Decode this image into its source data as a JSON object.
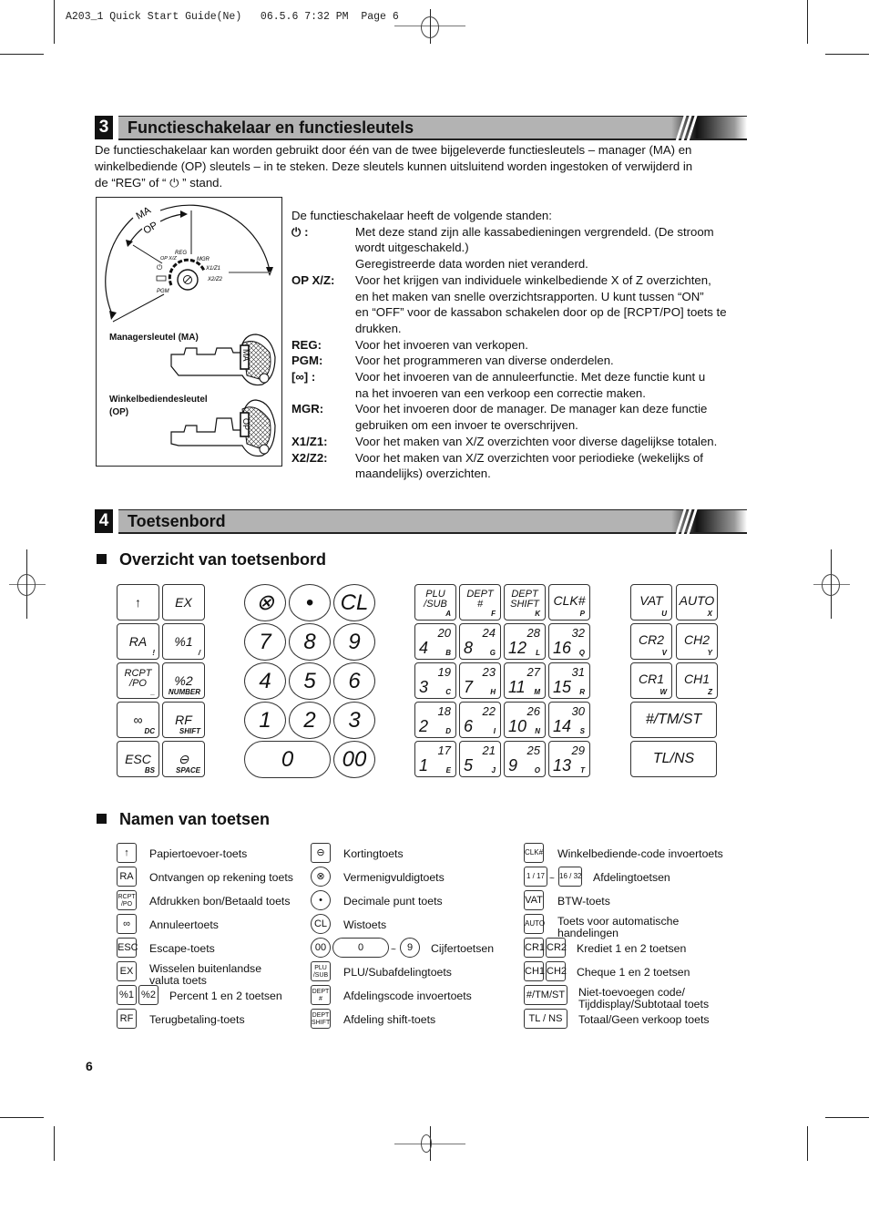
{
  "print_header": {
    "text": "A203_1 Quick Start Guide(Ne)   06.5.6 7:32 PM  Page 6"
  },
  "section3": {
    "number": "3",
    "title": "Functieschakelaar en functiesleutels",
    "intro": [
      "De functieschakelaar kan worden gebruikt door één van de twee bijgeleverde functiesleutels – manager (MA) en",
      "winkelbediende (OP) sleutels – in te steken. Deze sleutels kunnen uitsluitend worden ingestoken of verwijderd in",
      "de “REG” of “ ⏻ ” stand."
    ],
    "diagram": {
      "arc_ma": "MA",
      "arc_op": "OP",
      "switch_labels": {
        "opxz": "OP X/Z",
        "reg": "REG",
        "mgr": "MGR",
        "x1z1": "X1/Z1",
        "x2z2": "X2/Z2",
        "off": "⏻",
        "void": "∞",
        "pgm": "PGM"
      },
      "key_ma_caption": "Managersleutel (MA)",
      "key_ma_tag": "MA",
      "key_op_caption_1": "Winkelbediendesleutel",
      "key_op_caption_2": "(OP)",
      "key_op_tag": "OP"
    },
    "positions_intro": "De functieschakelaar heeft de volgende standen:",
    "positions": [
      {
        "key": "⏻ :",
        "lines": [
          "Met deze stand zijn alle kassabedieningen vergrendeld. (De stroom",
          "wordt uitgeschakeld.)",
          "Geregistreerde data worden niet veranderd."
        ]
      },
      {
        "key": "OP X/Z:",
        "lines": [
          "Voor het krijgen van individuele winkelbediende X of Z overzichten,",
          "en het maken van snelle  overzichtsrapporten. U kunt tussen “ON”",
          "en “OFF” voor de kassabon schakelen door op de [RCPT/PO] toets te",
          "drukken."
        ]
      },
      {
        "key": "REG:",
        "lines": [
          "Voor het invoeren van verkopen."
        ]
      },
      {
        "key": "PGM:",
        "lines": [
          "Voor het programmeren van diverse onderdelen."
        ]
      },
      {
        "key": "[∞] :",
        "lines": [
          "Voor het invoeren van de annuleerfunctie. Met deze functie kunt u",
          "na het invoeren van een verkoop een correctie maken."
        ]
      },
      {
        "key": "MGR:",
        "lines": [
          "Voor het invoeren door de manager. De manager kan deze functie",
          "gebruiken om een invoer te overschrijven."
        ]
      },
      {
        "key": "X1/Z1:",
        "lines": [
          "Voor het maken van X/Z overzichten voor diverse dagelijkse totalen."
        ]
      },
      {
        "key": "X2/Z2:",
        "lines": [
          "Voor het maken van X/Z overzichten voor periodieke (wekelijks of",
          "maandelijks) overzichten."
        ]
      }
    ]
  },
  "section4": {
    "number": "4",
    "title": "Toetsenbord",
    "overview_heading": "Overzicht van toetsenbord",
    "names_heading": "Namen van toetsen"
  },
  "keyboard": {
    "function_keys": [
      {
        "main": "↑",
        "sub": ""
      },
      {
        "main": "EX",
        "sub": ""
      },
      {
        "main": "RA",
        "sub": "!"
      },
      {
        "main": "%1",
        "sub": "/"
      },
      {
        "main": "RCPT\n/PO",
        "sub": "_"
      },
      {
        "main": "%2",
        "sub": "NUMBER"
      },
      {
        "main": "∞",
        "sub": "DC"
      },
      {
        "main": "RF",
        "sub": "SHIFT"
      },
      {
        "main": "ESC",
        "sub": "BS"
      },
      {
        "main": "⊖",
        "sub": "SPACE"
      }
    ],
    "numeric_keys": [
      "⊗",
      "•",
      "CL",
      "7",
      "8",
      "9",
      "4",
      "5",
      "6",
      "1",
      "2",
      "3",
      "0",
      "00"
    ],
    "dept_top": [
      {
        "main": "PLU\n/SUB",
        "sub": "A"
      },
      {
        "main": "DEPT\n#",
        "sub": "F"
      },
      {
        "main": "DEPT\nSHIFT",
        "sub": "K"
      },
      {
        "main": "CLK#",
        "sub": "P"
      }
    ],
    "dept_keys": [
      {
        "top": "20",
        "bottom": "4",
        "letter": "B"
      },
      {
        "top": "24",
        "bottom": "8",
        "letter": "G"
      },
      {
        "top": "28",
        "bottom": "12",
        "letter": "L"
      },
      {
        "top": "32",
        "bottom": "16",
        "letter": "Q"
      },
      {
        "top": "19",
        "bottom": "3",
        "letter": "C"
      },
      {
        "top": "23",
        "bottom": "7",
        "letter": "H"
      },
      {
        "top": "27",
        "bottom": "11",
        "letter": "M"
      },
      {
        "top": "31",
        "bottom": "15",
        "letter": "R"
      },
      {
        "top": "18",
        "bottom": "2",
        "letter": "D"
      },
      {
        "top": "22",
        "bottom": "6",
        "letter": "I"
      },
      {
        "top": "26",
        "bottom": "10",
        "letter": "N"
      },
      {
        "top": "30",
        "bottom": "14",
        "letter": "S"
      },
      {
        "top": "17",
        "bottom": "1",
        "letter": "E"
      },
      {
        "top": "21",
        "bottom": "5",
        "letter": "J"
      },
      {
        "top": "25",
        "bottom": "9",
        "letter": "O"
      },
      {
        "top": "29",
        "bottom": "13",
        "letter": "T"
      }
    ],
    "right_keys": [
      {
        "main": "VAT",
        "sub": "U"
      },
      {
        "main": "AUTO",
        "sub": "X"
      },
      {
        "main": "CR2",
        "sub": "V"
      },
      {
        "main": "CH2",
        "sub": "Y"
      },
      {
        "main": "CR1",
        "sub": "W"
      },
      {
        "main": "CH1",
        "sub": "Z"
      }
    ],
    "wide_keys": [
      "#/TM/ST",
      "TL/NS"
    ]
  },
  "key_names": {
    "col1": [
      {
        "keys": [
          "↑"
        ],
        "label": "Papiertoevoer-toets"
      },
      {
        "keys": [
          "RA"
        ],
        "label": "Ontvangen op rekening toets"
      },
      {
        "keys": [
          "RCPT\n/PO"
        ],
        "label": "Afdrukken bon/Betaald toets"
      },
      {
        "keys": [
          "∞"
        ],
        "label": "Annuleertoets"
      },
      {
        "keys": [
          "ESC"
        ],
        "label": "Escape-toets"
      },
      {
        "keys": [
          "EX"
        ],
        "label": "Wisselen buitenlandse\nvaluta toets"
      },
      {
        "keys": [
          "%1",
          "%2"
        ],
        "label": "Percent 1 en 2 toetsen"
      },
      {
        "keys": [
          "RF"
        ],
        "label": "Terugbetaling-toets"
      }
    ],
    "col2": [
      {
        "keys": [
          "⊖"
        ],
        "label": "Kortingtoets"
      },
      {
        "keys": [
          "⊗"
        ],
        "label": "Vermenigvuldigtoets"
      },
      {
        "keys": [
          "•"
        ],
        "label": "Decimale punt toets"
      },
      {
        "keys": [
          "CL"
        ],
        "label": "Wistoets"
      },
      {
        "keys": [
          "00",
          "0",
          "~",
          "9"
        ],
        "label": "Cijfertoetsen"
      },
      {
        "keys": [
          "PLU\n/SUB"
        ],
        "label": "PLU/Subafdelingtoets"
      },
      {
        "keys": [
          "DEPT\n#"
        ],
        "label": "Afdelingscode invoertoets"
      },
      {
        "keys": [
          "DEPT\nSHIFT"
        ],
        "label": "Afdeling shift-toets"
      }
    ],
    "col3": [
      {
        "keys": [
          "CLK#"
        ],
        "label": "Winkelbediende-code invoertoets"
      },
      {
        "keys": [
          "1 / 17",
          "~",
          "16 / 32"
        ],
        "label": "Afdelingtoetsen"
      },
      {
        "keys": [
          "VAT"
        ],
        "label": "BTW-toets"
      },
      {
        "keys": [
          "AUTO"
        ],
        "label": "Toets voor automatische\nhandelingen"
      },
      {
        "keys": [
          "CR1",
          "CR2"
        ],
        "label": "Krediet 1 en 2 toetsen"
      },
      {
        "keys": [
          "CH1",
          "CH2"
        ],
        "label": "Cheque 1 en 2 toetsen"
      },
      {
        "keys": [
          "#/TM/ST"
        ],
        "label": "Niet-toevoegen code/\nTijddisplay/Subtotaal toets"
      },
      {
        "keys": [
          "TL / NS"
        ],
        "label": "Totaal/Geen verkoop toets"
      }
    ]
  },
  "page_number": "6"
}
